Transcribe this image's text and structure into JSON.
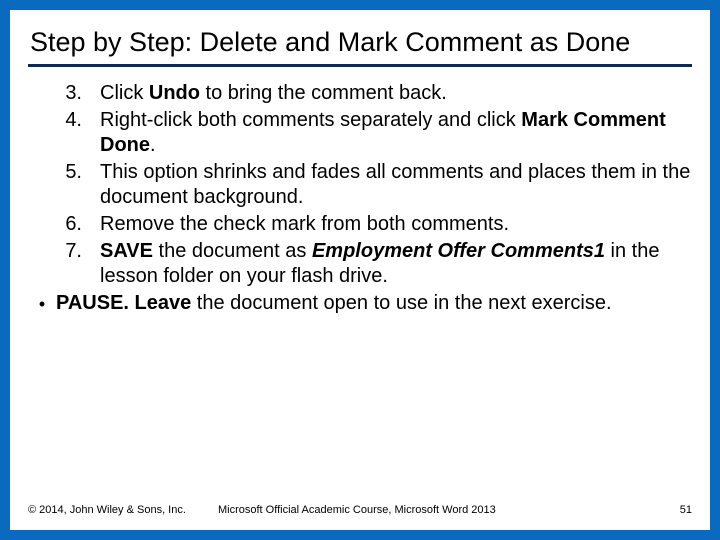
{
  "title": "Step by Step: Delete and Mark Comment as Done",
  "steps": [
    {
      "n": "3.",
      "pre": "Click ",
      "b1": "Undo",
      "post": " to bring the comment back."
    },
    {
      "n": "4.",
      "pre": "Right-click both comments separately and click ",
      "b1": "Mark Comment Done",
      "post": "."
    },
    {
      "n": "5.",
      "pre": "This option shrinks and fades all comments and places them in the document background.",
      "b1": "",
      "post": ""
    },
    {
      "n": "6.",
      "pre": "Remove the check mark from both comments.",
      "b1": "",
      "post": ""
    },
    {
      "n": "7.",
      "pre": " ",
      "b1": "SAVE",
      "post": " the document as ",
      "bi": "Employment Offer Comments1",
      "tail": " in the lesson folder on your flash drive."
    }
  ],
  "pause": {
    "b": "PAUSE. Leave",
    "rest": " the document open to use in the next exercise."
  },
  "footer": {
    "left": "© 2014, John Wiley & Sons, Inc.",
    "mid": "Microsoft Official Academic Course, Microsoft Word 2013",
    "right": "51"
  }
}
